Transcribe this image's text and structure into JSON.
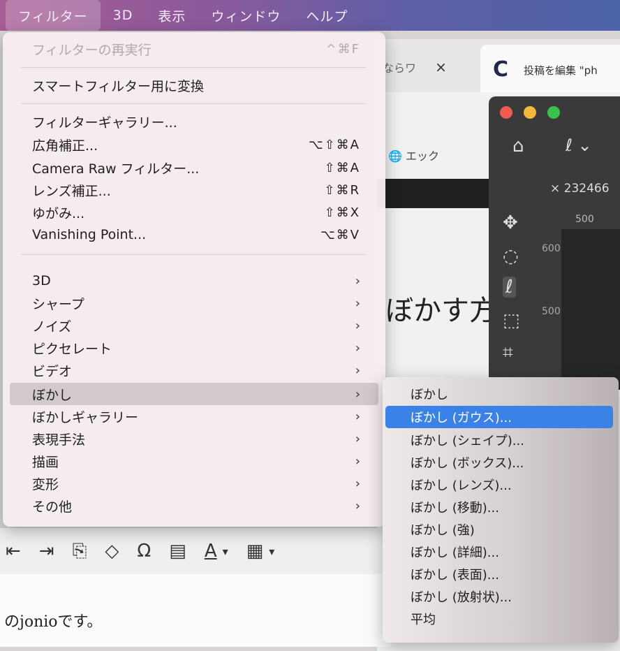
{
  "menubar": {
    "items": [
      "フィルター",
      "3D",
      "表示",
      "ウィンドウ",
      "ヘルプ"
    ]
  },
  "background": {
    "browser_tab1": {
      "label": "ならワ",
      "close": "×"
    },
    "browser_tab2": {
      "logo": "C",
      "label": "投稿を編集 \"ph"
    },
    "wp_toolbar_text": "エック",
    "wp_heading": "ぼかす方",
    "editor_text": "のjonioです。",
    "editor_toolbar_icons": [
      "⇤",
      "⇥",
      "⎘",
      "◇",
      "Ω",
      "▤",
      "A",
      "▾",
      "▦",
      "▾"
    ],
    "photoshop": {
      "tab_name": "232466",
      "ruler_value": "500",
      "vertical_ruler_1": "600",
      "vertical_ruler_2": "500",
      "tools": [
        "✥",
        "◌",
        "ℓ",
        "⬚",
        "⌗"
      ],
      "home_icon": "⌂",
      "lasso_icon": "ℓ ⌄"
    }
  },
  "filter_menu": {
    "items": [
      {
        "label": "フィルターの再実行",
        "shortcut": "^⌘F",
        "disabled": true
      },
      {
        "label": "スマートフィルター用に変換"
      },
      {
        "label": "フィルターギャラリー..."
      },
      {
        "label": "広角補正...",
        "shortcut": "⌥⇧⌘A"
      },
      {
        "label": "Camera Raw フィルター...",
        "shortcut": "⇧⌘A"
      },
      {
        "label": "レンズ補正...",
        "shortcut": "⇧⌘R"
      },
      {
        "label": "ゆがみ...",
        "shortcut": "⇧⌘X"
      },
      {
        "label": "Vanishing Point...",
        "shortcut": "⌥⌘V"
      },
      {
        "label": "3D",
        "submenu": true
      },
      {
        "label": "シャープ",
        "submenu": true
      },
      {
        "label": "ノイズ",
        "submenu": true
      },
      {
        "label": "ピクセレート",
        "submenu": true
      },
      {
        "label": "ビデオ",
        "submenu": true
      },
      {
        "label": "ぼかし",
        "submenu": true,
        "highlighted": true
      },
      {
        "label": "ぼかしギャラリー",
        "submenu": true
      },
      {
        "label": "表現手法",
        "submenu": true
      },
      {
        "label": "描画",
        "submenu": true
      },
      {
        "label": "変形",
        "submenu": true
      },
      {
        "label": "その他",
        "submenu": true
      }
    ],
    "arrow_glyph": "›"
  },
  "blur_submenu": {
    "items": [
      {
        "label": "ぼかし"
      },
      {
        "label": "ぼかし (ガウス)...",
        "selected": true
      },
      {
        "label": "ぼかし (シェイプ)..."
      },
      {
        "label": "ぼかし (ボックス)..."
      },
      {
        "label": "ぼかし (レンズ)..."
      },
      {
        "label": "ぼかし (移動)..."
      },
      {
        "label": "ぼかし (強)"
      },
      {
        "label": "ぼかし (詳細)..."
      },
      {
        "label": "ぼかし (表面)..."
      },
      {
        "label": "ぼかし (放射状)..."
      },
      {
        "label": "平均"
      }
    ]
  },
  "colors": {
    "selection": "#3b82e8",
    "highlight": "#d2c9cc",
    "traffic_red": "#f05a50",
    "traffic_yellow": "#f4b93a",
    "traffic_green": "#38c24a"
  }
}
